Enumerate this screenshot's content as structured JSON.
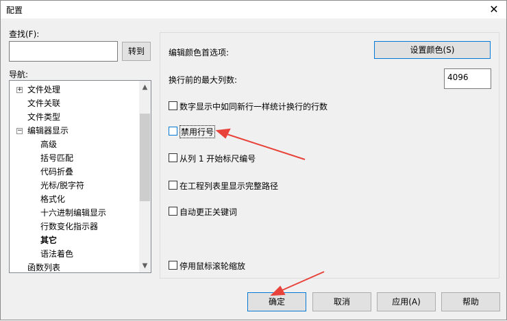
{
  "window": {
    "title": "配置",
    "close_glyph": "✕"
  },
  "search": {
    "label": "查找(F):",
    "value": "",
    "goto_button": "转到"
  },
  "nav": {
    "label": "导航:",
    "items": [
      {
        "label": "文件处理",
        "expander": "+",
        "bold": false
      },
      {
        "label": "文件关联",
        "expander": "",
        "bold": false
      },
      {
        "label": "文件类型",
        "expander": "",
        "bold": false
      },
      {
        "label": "编辑器显示",
        "expander": "−",
        "bold": false
      },
      {
        "label": "高级",
        "expander": "",
        "bold": false
      },
      {
        "label": "括号匹配",
        "expander": "",
        "bold": false
      },
      {
        "label": "代码折叠",
        "expander": "",
        "bold": false
      },
      {
        "label": "光标/脱字符",
        "expander": "",
        "bold": false
      },
      {
        "label": "格式化",
        "expander": "",
        "bold": false
      },
      {
        "label": "十六进制编辑显示",
        "expander": "",
        "bold": false
      },
      {
        "label": "行数变化指示器",
        "expander": "",
        "bold": false
      },
      {
        "label": "其它",
        "expander": "",
        "bold": true
      },
      {
        "label": "语法着色",
        "expander": "",
        "bold": false
      },
      {
        "label": "函数列表",
        "expander": "",
        "bold": false
      }
    ]
  },
  "options": {
    "color_pref_label": "编辑颜色首选项:",
    "set_color_button": "设置颜色(S)",
    "max_cols_label": "换行前的最大列数:",
    "max_cols_value": "4096",
    "checkboxes": [
      {
        "label": "数字显示中如同新行一样统计换行的行数",
        "checked": false
      },
      {
        "label": "禁用行号",
        "checked": false
      },
      {
        "label": "从列 1 开始标尺编号",
        "checked": false
      },
      {
        "label": "在工程列表里显示完整路径",
        "checked": false
      },
      {
        "label": "自动更正关键词",
        "checked": false
      },
      {
        "label": "停用鼠标滚轮缩放",
        "checked": false
      }
    ]
  },
  "footer": {
    "ok": "确定",
    "cancel": "取消",
    "apply": "应用(A)",
    "help": "帮助"
  },
  "colors": {
    "accent": "#0078d7",
    "annotation_arrow": "#e8423a"
  }
}
